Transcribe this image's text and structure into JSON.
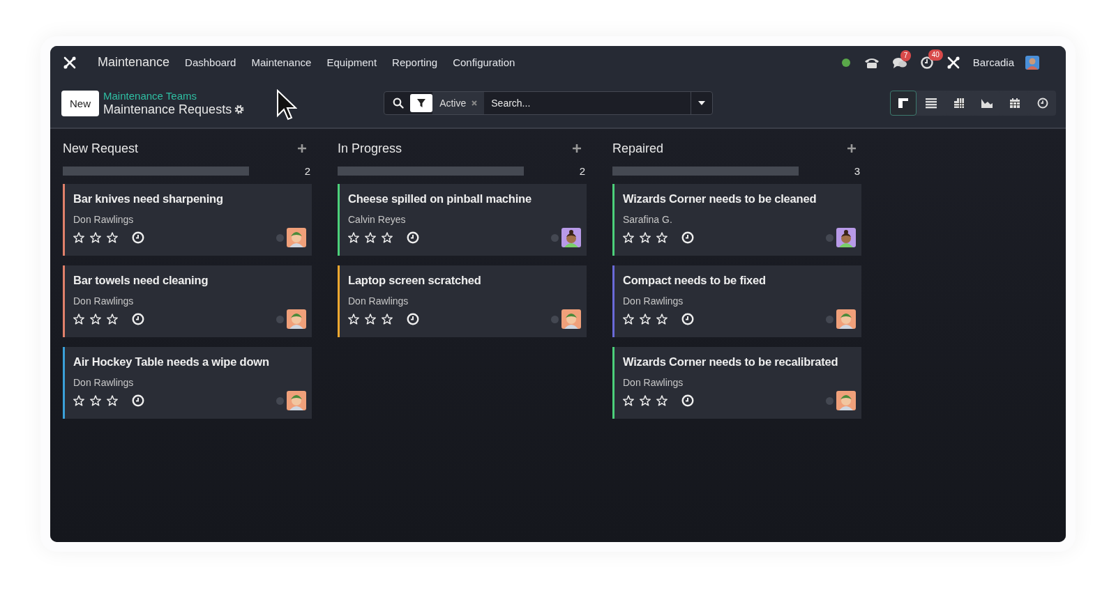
{
  "navbar": {
    "app_name": "Maintenance",
    "menus": [
      "Dashboard",
      "Maintenance",
      "Equipment",
      "Reporting",
      "Configuration"
    ],
    "status_online": true,
    "messages_badge": "7",
    "activities_badge": "40",
    "company": "Barcadia"
  },
  "control_panel": {
    "new_button": "New",
    "breadcrumb": "Maintenance Teams",
    "title": "Maintenance Requests",
    "filter_facet": "Active",
    "search": {
      "placeholder": "Search..."
    },
    "views": [
      {
        "kind": "kanban",
        "selected": true
      },
      {
        "kind": "list",
        "selected": false
      },
      {
        "kind": "pivot",
        "selected": false
      },
      {
        "kind": "graph",
        "selected": false
      },
      {
        "kind": "calendar",
        "selected": false
      },
      {
        "kind": "activity",
        "selected": false
      }
    ]
  },
  "columns": [
    {
      "title": "New Request",
      "count": "2",
      "level": 1,
      "cards": [
        {
          "title": "Bar knives need sharpening",
          "person": "Don Rawlings",
          "stars": 0,
          "color": "#e0806a",
          "avatar": {
            "kind": "cap",
            "color": "#f0a07a"
          }
        },
        {
          "title": "Bar towels need cleaning",
          "person": "Don Rawlings",
          "stars": 0,
          "color": "#e0806a",
          "avatar": {
            "kind": "cap",
            "color": "#f0a07a"
          }
        },
        {
          "title": "Air Hockey Table needs a wipe down",
          "person": "Don Rawlings",
          "stars": 0,
          "color": "#3aa0d8",
          "avatar": {
            "kind": "cap",
            "color": "#f0a07a"
          }
        }
      ]
    },
    {
      "title": "In Progress",
      "count": "2",
      "level": 1,
      "cards": [
        {
          "title": "Cheese spilled on pinball machine",
          "person": "Calvin Reyes",
          "stars": 0,
          "color": "#4cd07a",
          "avatar": {
            "kind": "bun",
            "color": "#b89ae8"
          }
        },
        {
          "title": "Laptop screen scratched",
          "person": "Don Rawlings",
          "stars": 0,
          "color": "#f0a830",
          "avatar": {
            "kind": "cap",
            "color": "#f0a07a"
          }
        }
      ]
    },
    {
      "title": "Repaired",
      "count": "3",
      "level": 1,
      "cards": [
        {
          "title": "Wizards Corner needs to be cleaned",
          "person": "Sarafina G.",
          "stars": 0,
          "color": "#4cd07a",
          "avatar": {
            "kind": "bun",
            "color": "#b89ae8"
          }
        },
        {
          "title": "Compact needs to be fixed",
          "person": "Don Rawlings",
          "stars": 0,
          "color": "#6a6ad8",
          "avatar": {
            "kind": "cap",
            "color": "#f0a07a"
          }
        },
        {
          "title": "Wizards Corner needs to be recalibrated",
          "person": "Don Rawlings",
          "stars": 0,
          "color": "#4cd07a",
          "avatar": {
            "kind": "cap",
            "color": "#f0a07a"
          }
        }
      ]
    }
  ]
}
